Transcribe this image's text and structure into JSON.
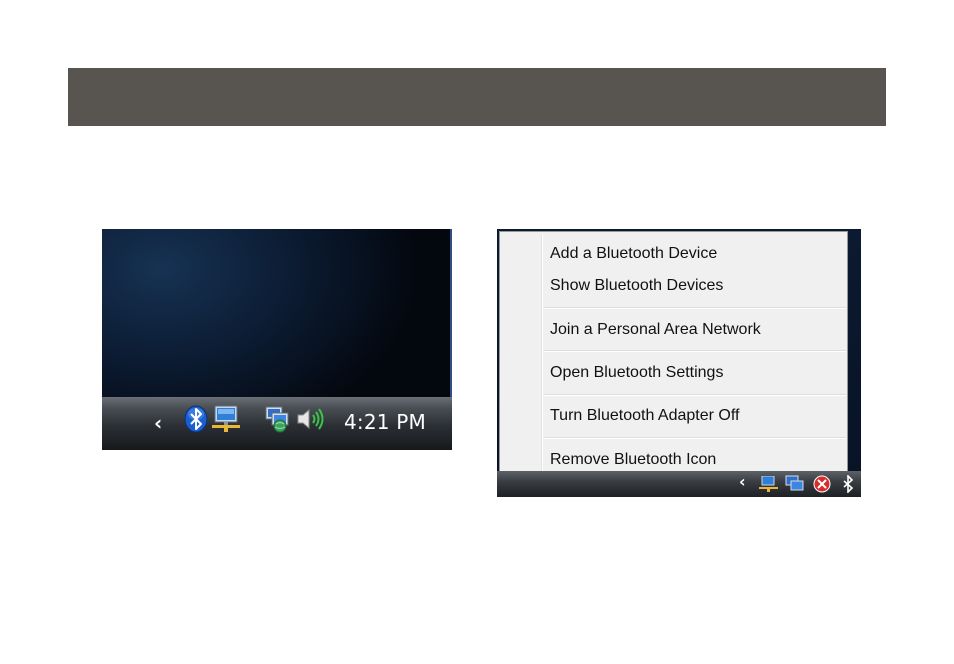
{
  "left_taskbar": {
    "clock": "4:21 PM",
    "icons": [
      "chevron-left-icon",
      "bluetooth-icon",
      "network-icon",
      "network-status-icon",
      "volume-icon"
    ]
  },
  "context_menu": {
    "items": [
      {
        "label": "Add a Bluetooth Device"
      },
      {
        "label": "Show Bluetooth Devices"
      },
      {
        "label": "Join a Personal Area Network"
      },
      {
        "label": "Open Bluetooth Settings"
      },
      {
        "label": "Turn Bluetooth Adapter Off"
      },
      {
        "label": "Remove Bluetooth Icon"
      }
    ]
  },
  "right_taskbar": {
    "icons": [
      "chevron-left-icon",
      "network-icon",
      "network-status-icon",
      "security-alert-icon",
      "bluetooth-icon"
    ]
  },
  "colors": {
    "banner": "#58544f",
    "menu_background": "#f0f0f0",
    "bluetooth_blue": "#1a5fd0"
  }
}
